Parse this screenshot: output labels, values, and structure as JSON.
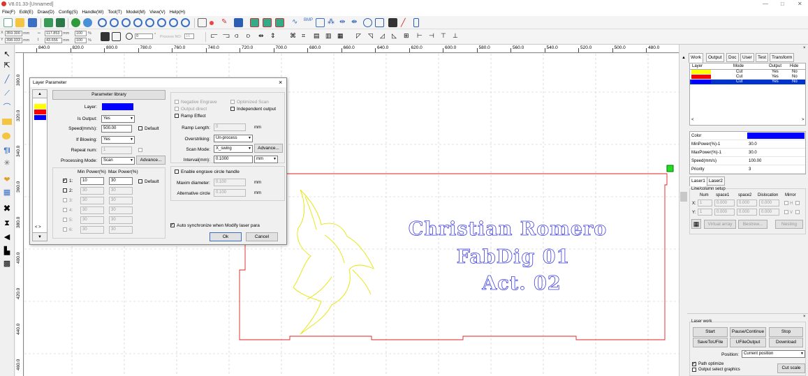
{
  "window": {
    "title": "V8.01.33-[Unnamed]",
    "minimize": "—",
    "maximize": "□",
    "close": "✕"
  },
  "menu": [
    "File(F)",
    "Edit(E)",
    "Draw(D)",
    "Config(S)",
    "Handle(W)",
    "Tool(T)",
    "Model(M)",
    "View(V)",
    "Help(H)"
  ],
  "toolbar2": {
    "x_label": "X",
    "x_value": "359.300",
    "x_unit": "mm",
    "y_label": "Y",
    "y_value": "398.033",
    "y_unit": "mm",
    "w_value": "117.853",
    "w_unit": "mm",
    "h_value": "43.656",
    "h_unit": "mm",
    "w_pct": "100",
    "h_pct": "100",
    "pct_unit": "%",
    "rotate_value": "0",
    "rotate_unit": "°",
    "process_no_label": "Process NO:",
    "process_no_value": "16"
  },
  "ruler_top": [
    "840.0",
    "820.0",
    "800.0",
    "780.0",
    "760.0",
    "740.0",
    "720.0",
    "700.0",
    "680.0",
    "660.0",
    "640.0",
    "620.0",
    "600.0",
    "580.0",
    "560.0",
    "540.0",
    "520.0",
    "500.0",
    "480.0"
  ],
  "ruler_left": [
    "300.0",
    "320.0",
    "340.0",
    "360.0",
    "380.0",
    "400.0",
    "420.0",
    "440.0",
    "460.0"
  ],
  "canvas": {
    "text_line1": "Christian Romero",
    "text_line2": "FabDig 01",
    "text_line3": "Act. 02",
    "line_color": "#3f3fe0",
    "cut_color": "#e02020",
    "bird_color": "#e6e600"
  },
  "right_panel": {
    "tabs": [
      "Work",
      "Output",
      "Doc",
      "User",
      "Test",
      "Transform"
    ],
    "layer_headers": [
      "Layer",
      "Mode",
      "Output",
      "Hide"
    ],
    "layers": [
      {
        "color": "#ffff00",
        "mode": "Cut",
        "output": "Yes",
        "hide": "No"
      },
      {
        "color": "#ff0000",
        "mode": "Cut",
        "output": "Yes",
        "hide": "No"
      },
      {
        "color": "#0000ff",
        "mode": "Cut",
        "output": "Yes",
        "hide": "No"
      }
    ],
    "props": [
      {
        "label": "Color",
        "value": ""
      },
      {
        "label": "MinPower(%)-1",
        "value": "30.0"
      },
      {
        "label": "MaxPower(%)-1",
        "value": "30.0"
      },
      {
        "label": "Speed(mm/s)",
        "value": "100.00"
      },
      {
        "label": "Priority",
        "value": "3"
      }
    ],
    "laser_tabs": [
      "Laser1",
      "Laser2"
    ],
    "line_column_setup": "Line/column setup",
    "lc_headers": [
      "Num",
      "space1",
      "space2",
      "Dislocation",
      "Mirror"
    ],
    "lc_x": {
      "label": "X:",
      "num": "1",
      "space1": "0.000",
      "space2": "0.000",
      "dislocation": "0.000",
      "mirror": "H"
    },
    "lc_y": {
      "label": "Y:",
      "num": "1",
      "space1": "0.000",
      "space2": "0.000",
      "dislocation": "0.000",
      "mirror": "V"
    },
    "virtual_array": "Virtual array",
    "bestrew": "Bestrew...",
    "nesting": "Nesting",
    "laser_work": "Laser work",
    "start": "Start",
    "pause": "Pause/Continue",
    "stop": "Stop",
    "save_to_file": "SaveToUFile",
    "ufile_output": "UFileOutput",
    "download": "Download",
    "position_label": "Position:",
    "position_value": "Current position",
    "path_optimize": "Path optimize",
    "output_select": "Output select graphics",
    "cut_scale": "Cut scale"
  },
  "dialog": {
    "title": "Layer Parameter",
    "param_library": "Parameter library",
    "layer_label": "Layer:",
    "layer_color": "#0000ff",
    "is_output_label": "Is Output:",
    "is_output_value": "Yes",
    "speed_label": "Speed(mm/s):",
    "speed_value": "500.00",
    "default_label": "Default",
    "if_blowing_label": "If Blowing:",
    "if_blowing_value": "Yes",
    "repeat_label": "Repeat num:",
    "repeat_value": "1",
    "processing_mode_label": "Processing Mode:",
    "processing_mode_value": "Scan",
    "advance": "Advance...",
    "min_power_header": "Min Power(%)",
    "max_power_header": "Max Power(%)",
    "power_rows": [
      {
        "id": "1:",
        "min": "10",
        "max": "30"
      },
      {
        "id": "2:",
        "min": "30",
        "max": "30"
      },
      {
        "id": "3:",
        "min": "30",
        "max": "30"
      },
      {
        "id": "4:",
        "min": "30",
        "max": "30"
      },
      {
        "id": "5:",
        "min": "30",
        "max": "30"
      },
      {
        "id": "6:",
        "min": "30",
        "max": "30"
      }
    ],
    "power_default": "Default",
    "negative_engrave": "Negative Engrave",
    "optimized_scan": "Optimized Scan",
    "output_direct": "Output direct",
    "independent_output": "Independent output",
    "ramp_effect": "Ramp Effect",
    "ramp_length_label": "Ramp Length:",
    "ramp_length_value": "0",
    "mm": "mm",
    "overstriking_label": "Overstriking:",
    "overstriking_value": "Un-process",
    "scan_mode_label": "Scan Mode:",
    "scan_mode_value": "X_swing",
    "scan_advance": "Advance...",
    "interval_label": "Interval(mm):",
    "interval_value": "0.1000",
    "interval_unit": "mm",
    "engrave_circle": "Enable engrave circle handle",
    "maxim_diameter_label": "Maxim diameter:",
    "maxim_diameter_value": "0.100",
    "alt_circle_label": "Alternative circle",
    "alt_circle_value": "0.100",
    "auto_sync": "Auto synchronize when Modify laser para",
    "ok": "Ok",
    "cancel": "Cancel",
    "layer_colors": [
      "#ffff00",
      "#ff0000",
      "#0000ff"
    ]
  }
}
